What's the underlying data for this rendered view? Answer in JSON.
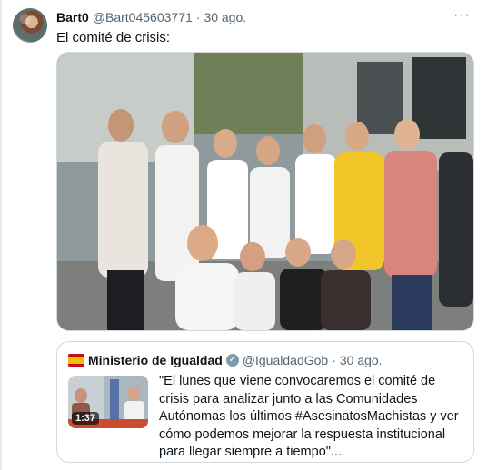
{
  "tweet": {
    "display_name": "Bart0",
    "handle": "@Bart045603771",
    "separator": "·",
    "time": "30 ago.",
    "more_glyph": "···",
    "text": "El comité de crisis:"
  },
  "quoted_tweet": {
    "display_name": "Ministerio de Igualdad",
    "verified_glyph": "✓",
    "handle": "@IgualdadGob",
    "separator": "·",
    "time": "30 ago.",
    "video_duration": "1:37",
    "text": "\"El lunes que viene convocaremos el comité de crisis para analizar junto a las Comunidades Autónomas los últimos #AsesinatosMachistas y ver cómo podemos mejorar la respuesta institucional para llegar siempre a tiempo\"..."
  },
  "icons": {
    "avatar": "avatar",
    "more": "more-icon",
    "verified": "verified-badge-icon",
    "flag": "spain-flag-icon"
  },
  "colors": {
    "text_primary": "#0f1419",
    "text_secondary": "#536471",
    "border": "#cfd9de",
    "verified_badge": "#829aab"
  }
}
